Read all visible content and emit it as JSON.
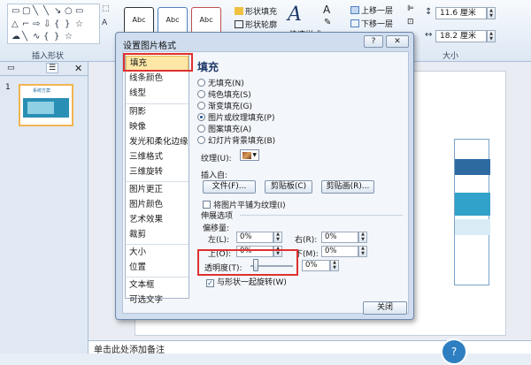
{
  "ribbon": {
    "insert_shapes_label": "插入形状",
    "shape_styles": [
      "Abc",
      "Abc",
      "Abc"
    ],
    "shape_fill": "形状填充",
    "shape_outline": "形状轮廓",
    "quick_styles": "快速样式",
    "bring_forward": "上移一层",
    "send_backward": "下移一层",
    "size_label": "大小",
    "height_value": "11.6 厘米",
    "width_value": "18.2 厘米"
  },
  "slides_pane": {
    "slide_number": "1",
    "thumb_title": "系统方案"
  },
  "notes": {
    "placeholder": "单击此处添加备注"
  },
  "help": {
    "glyph": "?"
  },
  "dialog": {
    "title": "设置图片格式",
    "help_btn": "?",
    "close_btn": "✕",
    "nav": [
      "填充",
      "线条颜色",
      "线型",
      "阴影",
      "映像",
      "发光和柔化边缘",
      "三维格式",
      "三维旋转",
      "图片更正",
      "图片颜色",
      "艺术效果",
      "裁剪",
      "大小",
      "位置",
      "文本框",
      "可选文字"
    ],
    "selected_nav": "填充",
    "panel_title": "填充",
    "fill_options": [
      "无填充(N)",
      "纯色填充(S)",
      "渐变填充(G)",
      "图片或纹理填充(P)",
      "图案填充(A)",
      "幻灯片背景填充(B)"
    ],
    "selected_fill": "图片或纹理填充(P)",
    "texture_label": "纹理(U):",
    "insert_from_label": "插入自:",
    "file_btn": "文件(F)...",
    "clipboard_btn": "剪贴板(C)",
    "clipart_btn": "剪贴画(R)...",
    "tile_checkbox": "将图片平铺为纹理(I)",
    "tile_checked": false,
    "stretch_options": "伸展选项",
    "offsets_label": "偏移量:",
    "left_label": "左(L):",
    "right_label": "右(R):",
    "top_label": "上(O):",
    "bottom_label": "下(M):",
    "left_value": "0%",
    "right_value": "0%",
    "top_value": "0%",
    "bottom_value": "0%",
    "transparency_label": "透明度(T):",
    "transparency_value": "0%",
    "transparency_level": 0,
    "rotate_checkbox": "与形状一起旋转(W)",
    "rotate_checked": true,
    "close_button": "关闭"
  },
  "colors": {
    "highlight_red": "#e03030",
    "selected_nav_bg": "#fde7a7"
  }
}
